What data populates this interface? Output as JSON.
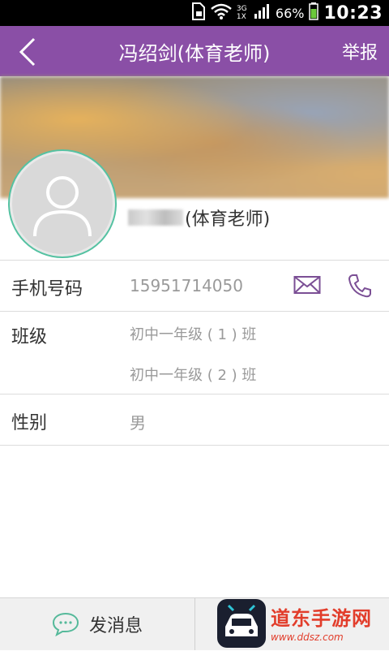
{
  "status_bar": {
    "network": "3G 1X",
    "battery": "66%",
    "time": "10:23"
  },
  "header": {
    "title": "冯绍剑(体育老师)",
    "report_label": "举报"
  },
  "profile": {
    "name_suffix": "(体育老师)"
  },
  "details": {
    "phone_label": "手机号码",
    "phone_value": "15951714050",
    "class_label": "班级",
    "classes": [
      "初中一年级 ( 1 ) 班",
      "初中一年级 ( 2 ) 班"
    ],
    "gender_label": "性别",
    "gender_value": "男"
  },
  "bottom_bar": {
    "send_message_label": "发消息"
  },
  "watermark": {
    "text": "道东手游网",
    "sub": "www.ddsz.com"
  },
  "colors": {
    "appbar": "#8a4fa6",
    "avatar_ring": "#55c2a2",
    "icon_purple": "#7b4f95",
    "chat_green": "#55b99a"
  }
}
